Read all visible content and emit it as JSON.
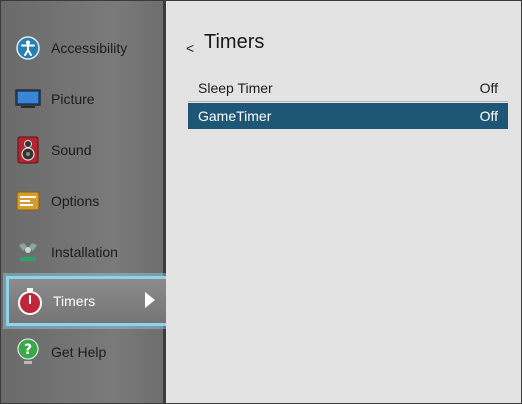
{
  "sidebar": {
    "items": [
      {
        "label": "Accessibility",
        "icon": "accessibility-icon"
      },
      {
        "label": "Picture",
        "icon": "picture-icon"
      },
      {
        "label": "Sound",
        "icon": "sound-icon"
      },
      {
        "label": "Options",
        "icon": "options-icon"
      },
      {
        "label": "Installation",
        "icon": "installation-icon"
      },
      {
        "label": "Timers",
        "icon": "timer-icon",
        "selected": true
      },
      {
        "label": "Get Help",
        "icon": "help-icon"
      }
    ]
  },
  "main": {
    "back_glyph": "<",
    "title": "Timers",
    "rows": [
      {
        "label": "Sleep Timer",
        "value": "Off"
      },
      {
        "label": "GameTimer",
        "value": "Off",
        "selected": true
      }
    ]
  },
  "colors": {
    "selection_row": "#1e5775",
    "focus_outline": "#8fd3ea",
    "sidebar_bg": "#767676",
    "content_bg": "#e3e3e3"
  }
}
